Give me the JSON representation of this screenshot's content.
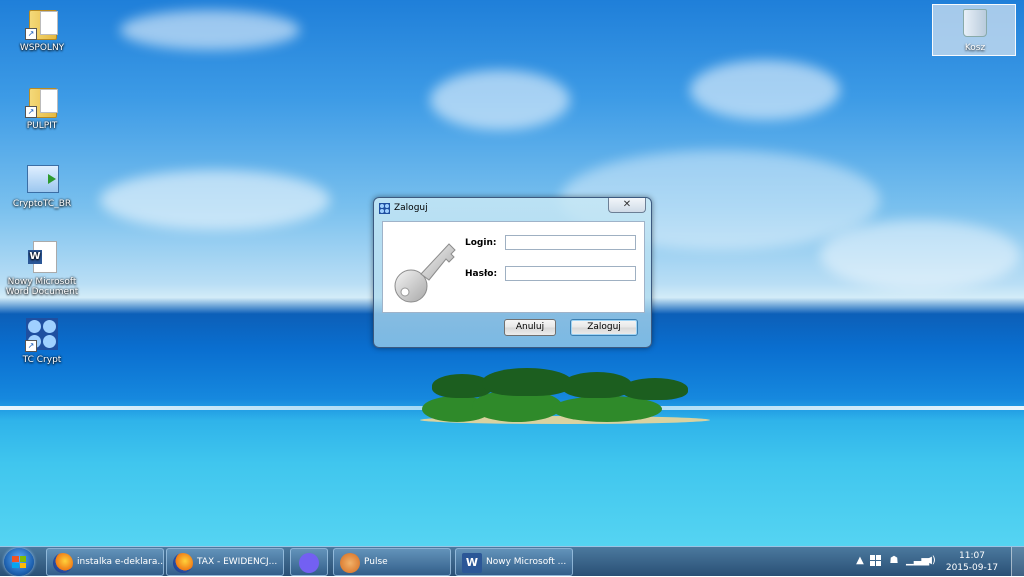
{
  "desktop": {
    "icons": [
      {
        "label": "WSPOLNY"
      },
      {
        "label": "PULPIT"
      },
      {
        "label": "CryptoTC_BR"
      },
      {
        "label": "Nowy Microsoft Word Document"
      },
      {
        "label": "TC Crypt"
      }
    ],
    "recycle_bin": {
      "label": "Kosz"
    }
  },
  "dialog": {
    "title": "Zaloguj",
    "close_symbol": "✕",
    "login_label": "Login:",
    "login_value": "",
    "password_label": "Hasło:",
    "password_value": "",
    "cancel_label": "Anuluj",
    "submit_label": "Zaloguj"
  },
  "taskbar": {
    "items": [
      {
        "label": "instalka e-deklara...",
        "icon": "firefox-icon"
      },
      {
        "label": "TAX - EWIDENCJ...",
        "icon": "firefox-icon"
      },
      {
        "label": "",
        "icon": "viber-icon"
      },
      {
        "label": "Pulse",
        "icon": "pulse-icon"
      },
      {
        "label": "Nowy Microsoft ...",
        "icon": "word-icon"
      }
    ],
    "tray": {
      "arrow": "▲",
      "time": "11:07",
      "date": "2015-09-17"
    }
  },
  "colors": {
    "accent": "#1c5fae",
    "dialog_frame": "#3c5a80",
    "sea": "#0a6fd0"
  }
}
